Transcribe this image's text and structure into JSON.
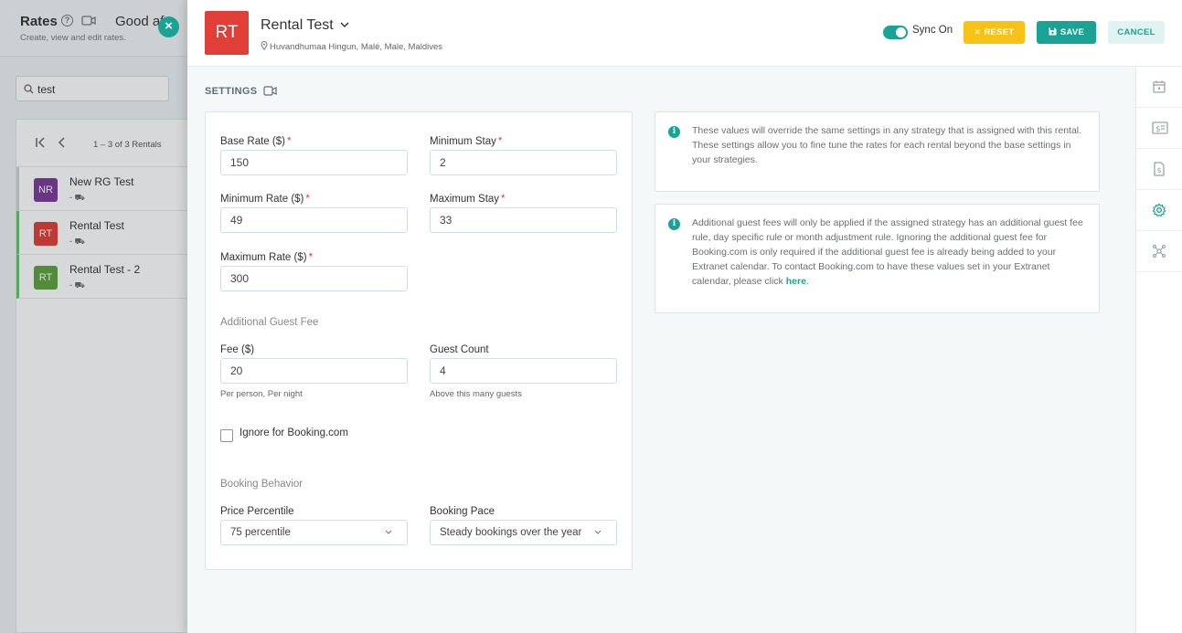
{
  "background": {
    "title": "Rates",
    "subtitle": "Create, view and edit rates.",
    "greeting": "Good af",
    "search_value": "test",
    "pager_text": "1 – 3 of 3 Rentals",
    "rentals": [
      {
        "initials": "NR",
        "name": "New RG Test",
        "meta": "- ⛟",
        "color": "#7b3a96"
      },
      {
        "initials": "RT",
        "name": "Rental Test",
        "meta": "- ⛟",
        "color": "#e03e36"
      },
      {
        "initials": "RT",
        "name": "Rental Test - 2",
        "meta": "- ⛟",
        "color": "#5da33f"
      }
    ]
  },
  "drawer": {
    "avatar": "RT",
    "title": "Rental Test",
    "location": "Huvandhumaa Hingun, Malé, Male, Maldives",
    "sync_label": "Sync On",
    "reset_label": "RESET",
    "save_label": "SAVE",
    "cancel_label": "CANCEL",
    "section_title": "SETTINGS",
    "form": {
      "base_rate_label": "Base Rate ($)",
      "base_rate": "150",
      "min_stay_label": "Minimum Stay",
      "min_stay": "2",
      "min_rate_label": "Minimum Rate ($)",
      "min_rate": "49",
      "max_stay_label": "Maximum Stay",
      "max_stay": "33",
      "max_rate_label": "Maximum Rate ($)",
      "max_rate": "300",
      "additional_fee_group": "Additional Guest Fee",
      "fee_label": "Fee ($)",
      "fee": "20",
      "fee_help": "Per person, Per night",
      "guest_count_label": "Guest Count",
      "guest_count": "4",
      "guest_count_help": "Above this many guests",
      "ignore_booking_label": "Ignore for Booking.com",
      "booking_group": "Booking Behavior",
      "price_percentile_label": "Price Percentile",
      "price_percentile": "75 percentile",
      "booking_pace_label": "Booking Pace",
      "booking_pace": "Steady bookings over the year"
    },
    "info1": "These values will override the same settings in any strategy that is assigned with this rental. These settings allow you to fine tune the rates for each rental beyond the base settings in your strategies.",
    "info2_text": "Additional guest fees will only be applied if the assigned strategy has an additional guest fee rule, day specific rule or month adjustment rule. Ignoring the additional guest fee for Booking.com is only required if the additional guest fee is already being added to your Extranet calendar. To contact Booking.com to have these values set in your Extranet calendar, please click ",
    "info2_link": "here",
    "info2_end": "."
  },
  "colors": {
    "accent": "#1aa394",
    "reset": "#f6c216",
    "required": "#e03e36"
  }
}
